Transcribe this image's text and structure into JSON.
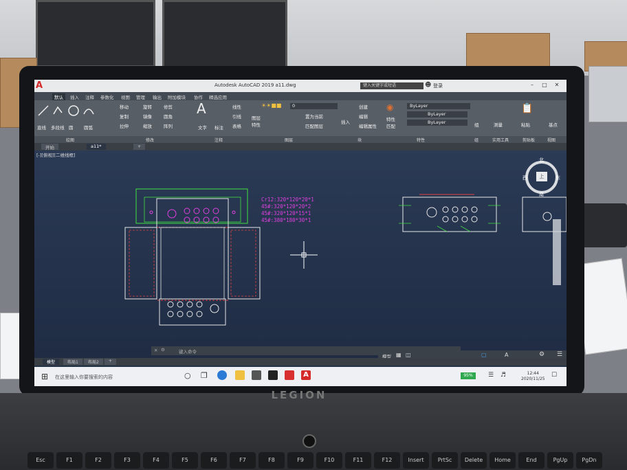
{
  "app": {
    "title": "Autodesk AutoCAD 2019    a11.dwg",
    "logo": "A",
    "search_placeholder": "键入关键字或短语",
    "user": "登录"
  },
  "menu": [
    "默认",
    "插入",
    "注释",
    "参数化",
    "视图",
    "管理",
    "输出",
    "附加模块",
    "协作",
    "精选应用"
  ],
  "ribbon": {
    "tools_draw": [
      "直线",
      "多段线",
      "圆",
      "圆弧"
    ],
    "tools_modify": [
      "移动",
      "旋转",
      "修剪",
      "复制",
      "镜像",
      "圆角",
      "拉伸",
      "缩放",
      "阵列"
    ],
    "tools_annotation": [
      "文字",
      "标注",
      "线性",
      "引线",
      "表格"
    ],
    "tools_layers": [
      "图层特性",
      "置为当前",
      "匹配图层"
    ],
    "layer_value": "0",
    "tools_block": [
      "插入",
      "创建",
      "编辑",
      "编辑属性"
    ],
    "tools_props": [
      "特性匹配"
    ],
    "bylayer": [
      "ByLayer",
      "ByLayer",
      "ByLayer"
    ],
    "tools_right": [
      "组",
      "测量",
      "粘贴",
      "基点"
    ],
    "panels": [
      "绘图",
      "修改",
      "注释",
      "图层",
      "块",
      "特性",
      "组",
      "实用工具",
      "剪贴板",
      "视图"
    ]
  },
  "file_tabs": [
    "开始",
    "a11*"
  ],
  "viewport_label": "[-][俯视][二维线框]",
  "drawing_notes": [
    "Cr12:320*120*20*1",
    "45#:320*120*20*2",
    "45#:320*120*15*1",
    "45#:380*180*30*1"
  ],
  "viewcube": {
    "top": "北",
    "left": "西",
    "right": "东",
    "bottom": "南",
    "face": "上"
  },
  "command_placeholder": "键入命令",
  "layout_tabs": [
    "模型",
    "布局1",
    "布局2"
  ],
  "status_model": "模型",
  "taskbar": {
    "search_placeholder": "在这里输入你要搜索的内容",
    "battery": "95%",
    "time": "12:44",
    "date": "2020/11/25"
  },
  "laptop_brand": "LEGION",
  "keys": [
    "Esc",
    "F1",
    "F2",
    "F3",
    "F4",
    "F5",
    "F6",
    "F7",
    "F8",
    "F9",
    "F10",
    "F11",
    "F12",
    "Insert",
    "PrtSc",
    "Delete",
    "Home",
    "End",
    "PgUp",
    "PgDn"
  ],
  "colors": {
    "viewport": "#243250",
    "accent_magenta": "#e040e0",
    "line_white": "#e8e8e8",
    "line_green": "#40e040",
    "line_red": "#e04040",
    "autocad_red": "#d42a2a"
  }
}
